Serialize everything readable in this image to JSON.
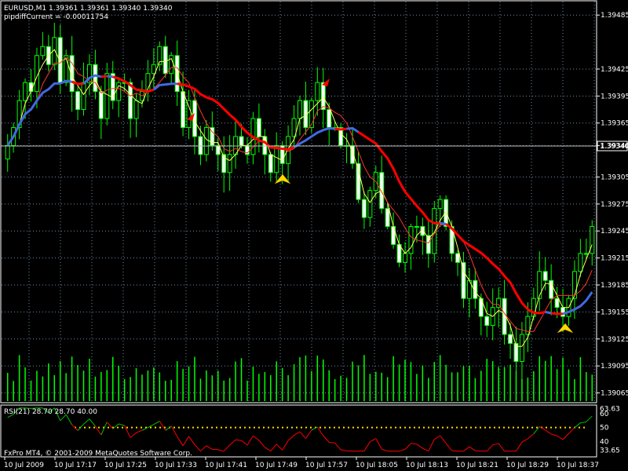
{
  "header": {
    "symbol_line": "EURUSD,M1  1.39361 1.39361 1.39340 1.39340",
    "indicator_line": "pipdiffCurrent = -0.00011754"
  },
  "rsi_panel": {
    "label": "RSI(21) 28.70 28.70 40.00",
    "levels": [
      50
    ],
    "ticks": [
      "63.63",
      "60",
      "50",
      "40",
      "33.65"
    ]
  },
  "footer": {
    "copyright": "FxPro MT4, © 2001-2009 MetaQuotes Software Corp."
  },
  "colors": {
    "background": "#000000",
    "candle": "#00ff00",
    "candle_body": "#ffffff",
    "grid": "#6b8ba8",
    "ma_up": "#4169e1",
    "ma_down": "#ff0000",
    "fast_ma": "#ffff66",
    "mid_ma": "#ff3333",
    "volume": "#00ff00",
    "rsi_green": "#00c000",
    "rsi_red": "#ff0000",
    "rsi_level": "#ffd700",
    "arrow_down": "#ff0000",
    "arrow_up": "#ffd700"
  },
  "chart_data": {
    "type": "candlestick",
    "price_ticks": [
      "1.39485",
      "1.39425",
      "1.39395",
      "1.39365",
      "1.39340",
      "1.39305",
      "1.39275",
      "1.39245",
      "1.39215",
      "1.39185",
      "1.39155",
      "1.39125",
      "1.39095",
      "1.39065"
    ],
    "current_price": "1.39340",
    "time_ticks": [
      "10 Jul 2009",
      "10 Jul 17:17",
      "10 Jul 17:25",
      "10 Jul 17:33",
      "10 Jul 17:41",
      "10 Jul 17:49",
      "10 Jul 17:57",
      "10 Jul 18:05",
      "10 Jul 18:13",
      "10 Jul 18:21",
      "10 Jul 18:29",
      "10 Jul 18:37"
    ],
    "ylim": [
      1.39055,
      1.395
    ],
    "close_series": [
      1.3934,
      1.3936,
      1.3939,
      1.3941,
      1.394,
      1.3944,
      1.3945,
      1.3943,
      1.3946,
      1.3941,
      1.3944,
      1.394,
      1.3938,
      1.3941,
      1.3943,
      1.394,
      1.3937,
      1.3942,
      1.3939,
      1.3941,
      1.3941,
      1.3937,
      1.3939,
      1.394,
      1.3942,
      1.3943,
      1.3945,
      1.3942,
      1.3944,
      1.394,
      1.3936,
      1.3939,
      1.3935,
      1.3933,
      1.3936,
      1.3934,
      1.3933,
      1.3931,
      1.3933,
      1.3935,
      1.3934,
      1.3933,
      1.3937,
      1.3935,
      1.3933,
      1.3931,
      1.3934,
      1.3932,
      1.3935,
      1.3937,
      1.3939,
      1.3936,
      1.3939,
      1.3941,
      1.3938,
      1.3936,
      1.3936,
      1.3934,
      1.3934,
      1.3932,
      1.3928,
      1.3926,
      1.3929,
      1.3931,
      1.3927,
      1.3925,
      1.3923,
      1.3921,
      1.3922,
      1.3925,
      1.3925,
      1.3924,
      1.3922,
      1.3927,
      1.3928,
      1.3925,
      1.3922,
      1.3921,
      1.3917,
      1.3919,
      1.3917,
      1.3915,
      1.3914,
      1.3916,
      1.3917,
      1.3913,
      1.3912,
      1.391,
      1.3913,
      1.3915,
      1.3917,
      1.392,
      1.3919,
      1.3917,
      1.3916,
      1.3915,
      1.3917,
      1.392,
      1.3922,
      1.3922,
      1.3925
    ]
  }
}
